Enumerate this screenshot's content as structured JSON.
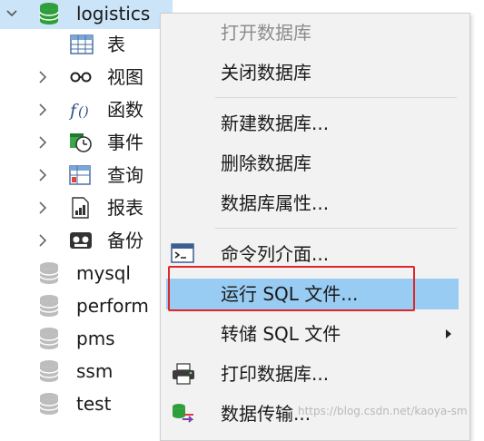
{
  "tree": {
    "database": "logistics",
    "children": [
      {
        "label": "表",
        "icon": "table-icon"
      },
      {
        "label": "视图",
        "icon": "view-glasses-icon"
      },
      {
        "label": "函数",
        "icon": "function-icon"
      },
      {
        "label": "事件",
        "icon": "event-clock-icon"
      },
      {
        "label": "查询",
        "icon": "query-icon"
      },
      {
        "label": "报表",
        "icon": "report-icon"
      },
      {
        "label": "备份",
        "icon": "backup-icon"
      }
    ],
    "databases": [
      "mysql",
      "perform",
      "pms",
      "ssm",
      "test"
    ],
    "colors": {
      "selected_row": "#cce4f7",
      "active_db_icon": "#2e9f3b",
      "inactive_db_icon": "#bdbdbd"
    }
  },
  "context_menu": {
    "items": [
      {
        "label": "打开数据库",
        "disabled": true
      },
      {
        "label": "关闭数据库"
      },
      {
        "label": "新建数据库..."
      },
      {
        "label": "删除数据库"
      },
      {
        "label": "数据库属性..."
      },
      {
        "label": "命令列介面...",
        "icon": "console-icon"
      },
      {
        "label": "运行 SQL 文件...",
        "highlighted": true
      },
      {
        "label": "转储 SQL 文件",
        "submenu": true
      },
      {
        "label": "打印数据库...",
        "icon": "printer-icon"
      },
      {
        "label": "数据传输...",
        "icon": "data-transfer-icon"
      }
    ],
    "colors": {
      "highlight": "#99ccf3",
      "annotation_box": "#e0262b"
    }
  },
  "watermark": "https://blog.csdn.net/kaoya-sm"
}
